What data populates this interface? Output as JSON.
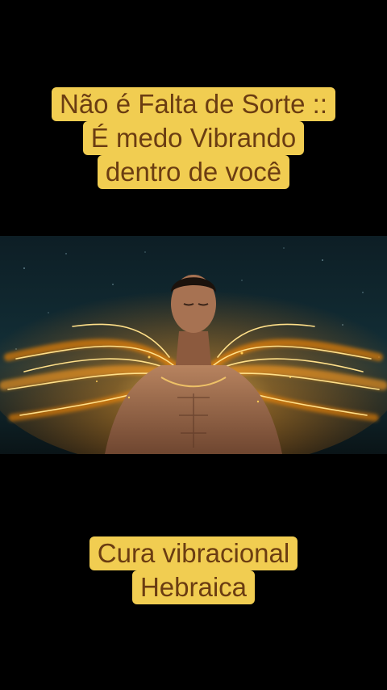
{
  "overlay": {
    "top_lines": [
      "Não é Falta de Sorte ::",
      "É medo Vibrando",
      "dentro de você"
    ],
    "bottom_lines": [
      "Cura vibracional",
      "Hebraica"
    ]
  },
  "colors": {
    "background": "#000000",
    "caption_bg": "#f1cd51",
    "caption_text": "#6b3d12",
    "energy": "#ffb400"
  },
  "image": {
    "subject": "man with eyes closed and glowing golden energy wings against night sky",
    "icon": "energy-wings-illustration"
  }
}
